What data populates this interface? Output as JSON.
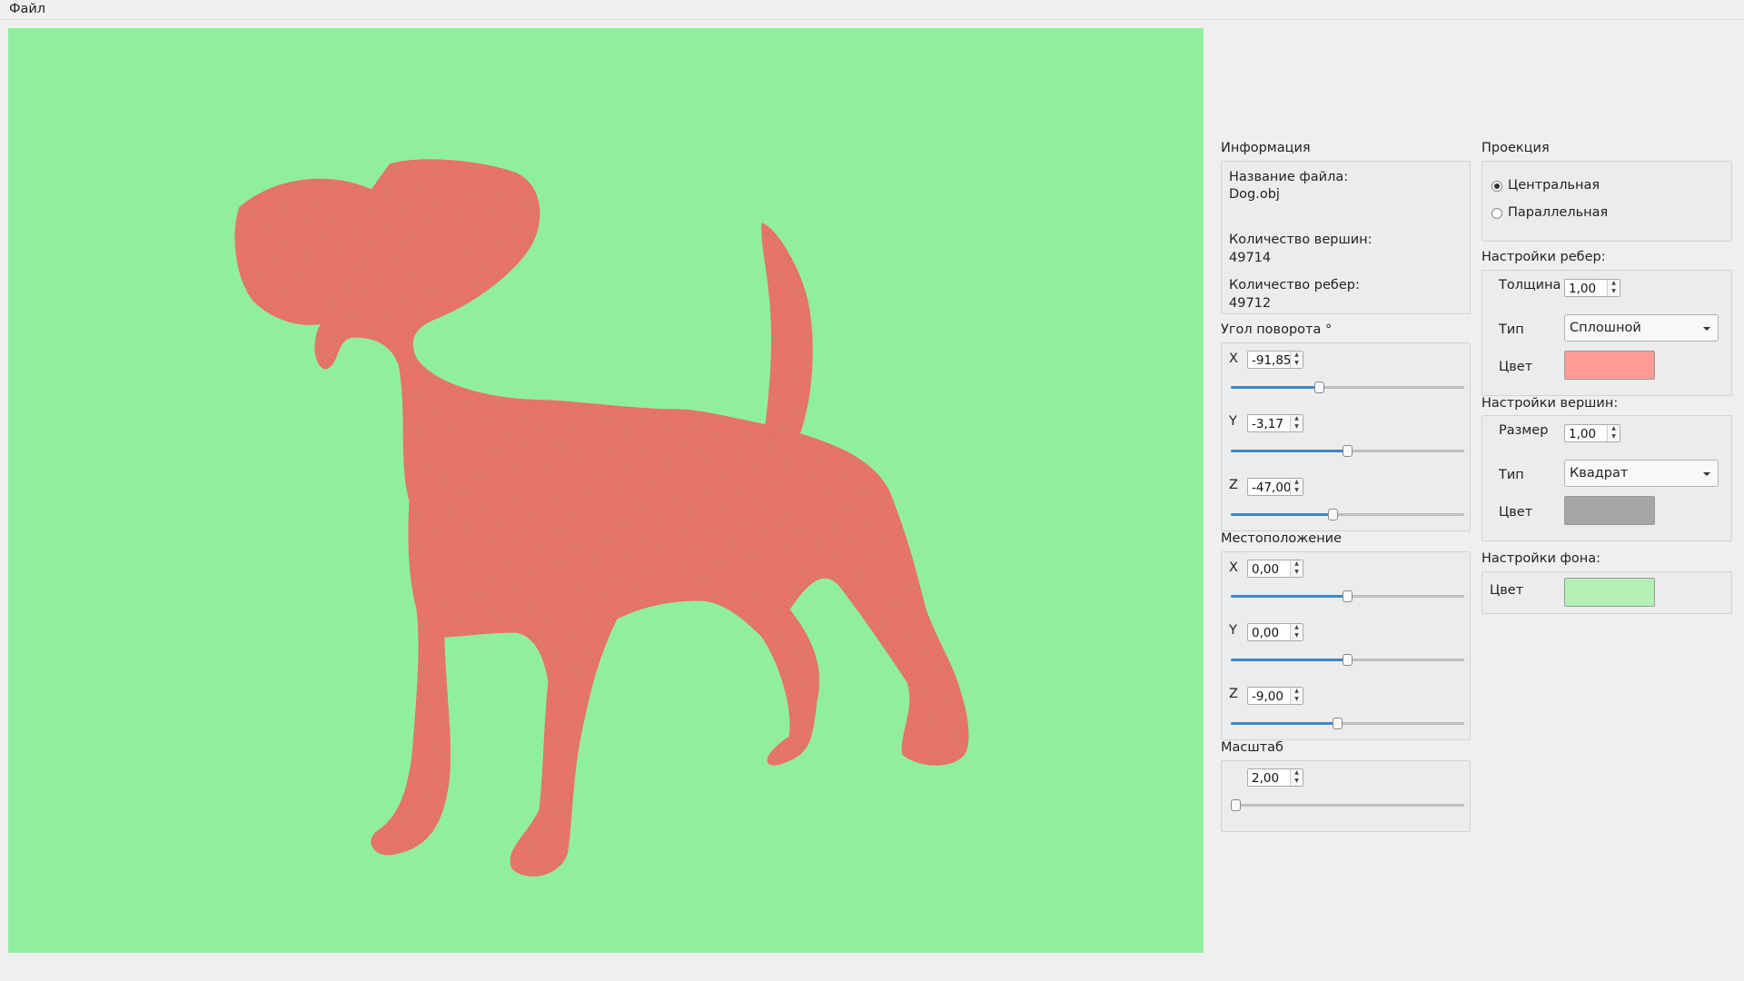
{
  "menu": {
    "file": "Файл"
  },
  "viewport": {
    "background_color": "#90ef9f",
    "model_fill_color": "#ee6d60",
    "mesh_color": "#b39a90",
    "model_icon": "dog-wireframe-model"
  },
  "info": {
    "title": "Информация",
    "file_name_label": "Название файла:",
    "file_name": "Dog.obj",
    "vertices_label": "Количество вершин:",
    "vertices": "49714",
    "edges_label": "Количество ребер:",
    "edges": "49712"
  },
  "rotation": {
    "title": "Угол поворота °",
    "x_label": "X",
    "x_value": "-91,85",
    "x_slider": 0.38,
    "y_label": "Y",
    "y_value": "-3,17",
    "y_slider": 0.5,
    "z_label": "Z",
    "z_value": "-47,00",
    "z_slider": 0.44
  },
  "position": {
    "title": "Местоположение",
    "x_label": "X",
    "x_value": "0,00",
    "x_slider": 0.5,
    "y_label": "Y",
    "y_value": "0,00",
    "y_slider": 0.5,
    "z_label": "Z",
    "z_value": "-9,00",
    "z_slider": 0.46
  },
  "scale": {
    "title": "Масштаб",
    "value": "2,00",
    "slider": 0.0
  },
  "projection": {
    "title": "Проекция",
    "central": "Центральная",
    "parallel": "Параллельная",
    "selected": "central"
  },
  "edges": {
    "title": "Настройки ребер:",
    "thickness_label": "Толщина",
    "thickness": "1,00",
    "type_label": "Тип",
    "type": "Сплошной",
    "color_label": "Цвет",
    "color": "#ff9a95"
  },
  "vertices": {
    "title": "Настройки  вершин:",
    "size_label": "Размер",
    "size": "1,00",
    "type_label": "Тип",
    "type": "Квадрат",
    "color_label": "Цвет",
    "color": "#a6a6a6"
  },
  "background": {
    "title": "Настройки  фона:",
    "color_label": "Цвет",
    "color": "#b2f0b6"
  }
}
